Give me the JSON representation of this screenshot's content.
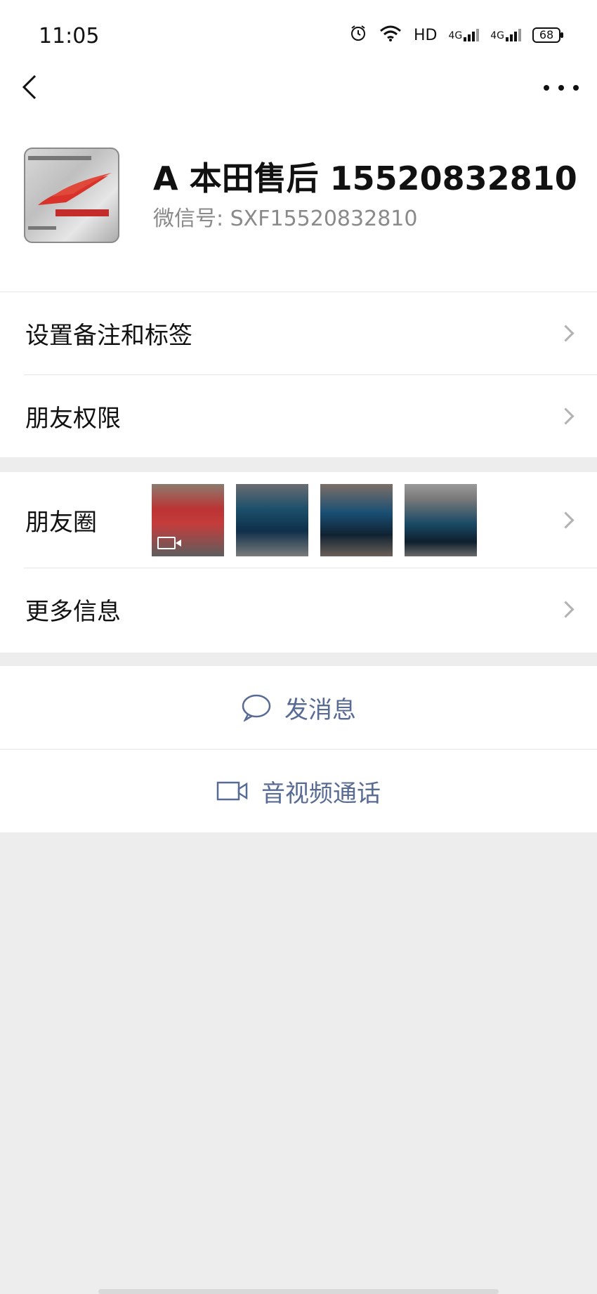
{
  "status_bar": {
    "time": "11:05",
    "network": "HD",
    "signal1": "4G",
    "signal2": "4G",
    "battery": "68"
  },
  "profile": {
    "name": "A 本田售后 15520832810",
    "wechat_id": "微信号: SXF15520832810"
  },
  "menu": {
    "remark_tags": "设置备注和标签",
    "friend_permissions": "朋友权限",
    "moments": "朋友圈",
    "more_info": "更多信息"
  },
  "actions": {
    "message": "发消息",
    "video_call": "音视频通话"
  },
  "colors": {
    "link": "#576b95",
    "chevron": "#b2b2b2",
    "background": "#ededed"
  }
}
